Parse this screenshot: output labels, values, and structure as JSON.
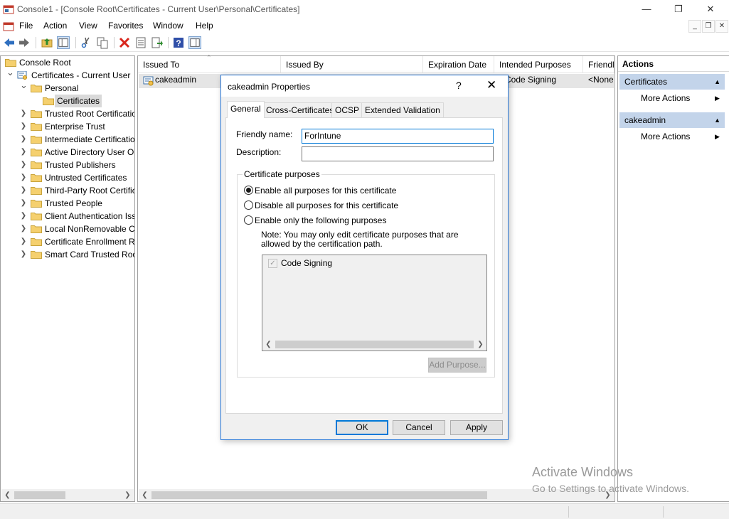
{
  "window": {
    "title": "Console1 - [Console Root\\Certificates - Current User\\Personal\\Certificates]",
    "min": "—",
    "max": "❐",
    "close": "✕"
  },
  "menu": {
    "items": [
      "File",
      "Action",
      "View",
      "Favorites",
      "Window",
      "Help"
    ],
    "mdi_min": "_",
    "mdi_restore": "❐",
    "mdi_close": "✕"
  },
  "tree": {
    "items": [
      {
        "label": "Console Root",
        "selected": false
      },
      {
        "label": "Certificates - Current User",
        "selected": false
      },
      {
        "label": "Personal",
        "selected": false
      },
      {
        "label": "Certificates",
        "selected": true
      },
      {
        "label": "Trusted Root Certification Authorities",
        "selected": false
      },
      {
        "label": "Enterprise Trust",
        "selected": false
      },
      {
        "label": "Intermediate Certification Authorities",
        "selected": false
      },
      {
        "label": "Active Directory User Object",
        "selected": false
      },
      {
        "label": "Trusted Publishers",
        "selected": false
      },
      {
        "label": "Untrusted Certificates",
        "selected": false
      },
      {
        "label": "Third-Party Root Certification Authorities",
        "selected": false
      },
      {
        "label": "Trusted People",
        "selected": false
      },
      {
        "label": "Client Authentication Issuers",
        "selected": false
      },
      {
        "label": "Local NonRemovable Certificates",
        "selected": false
      },
      {
        "label": "Certificate Enrollment Requests",
        "selected": false
      },
      {
        "label": "Smart Card Trusted Roots",
        "selected": false
      }
    ]
  },
  "list": {
    "columns": [
      "Issued To",
      "Issued By",
      "Expiration Date",
      "Intended Purposes",
      "Friendly Name"
    ],
    "rows": [
      {
        "issued_to": "cakeadmin",
        "intended_purposes": "Code Signing",
        "friendly_name": "<None>"
      }
    ]
  },
  "actions": {
    "title": "Actions",
    "groups": [
      {
        "label": "Certificates",
        "item": "More Actions"
      },
      {
        "label": "cakeadmin",
        "item": "More Actions"
      }
    ]
  },
  "watermark": {
    "line1": "Activate Windows",
    "line2": "Go to Settings to activate Windows."
  },
  "dialog": {
    "title": "cakeadmin Properties",
    "help": "?",
    "close": "✕",
    "tabs": [
      "General",
      "Cross-Certificates",
      "OCSP",
      "Extended Validation"
    ],
    "active_tab": "General",
    "friendly_name_label": "Friendly name:",
    "friendly_name_value": "ForIntune",
    "description_label": "Description:",
    "description_value": "",
    "purposes_legend": "Certificate purposes",
    "radio_options": [
      {
        "label": "Enable all purposes for this certificate",
        "checked": true
      },
      {
        "label": "Disable all purposes for this certificate",
        "checked": false
      },
      {
        "label": "Enable only the following purposes",
        "checked": false
      }
    ],
    "note": "Note: You may only edit certificate purposes that are allowed by the certification path.",
    "purpose_items": [
      {
        "label": "Code Signing",
        "checked": true
      }
    ],
    "add_purpose": "Add Purpose...",
    "ok": "OK",
    "cancel": "Cancel",
    "apply": "Apply"
  }
}
